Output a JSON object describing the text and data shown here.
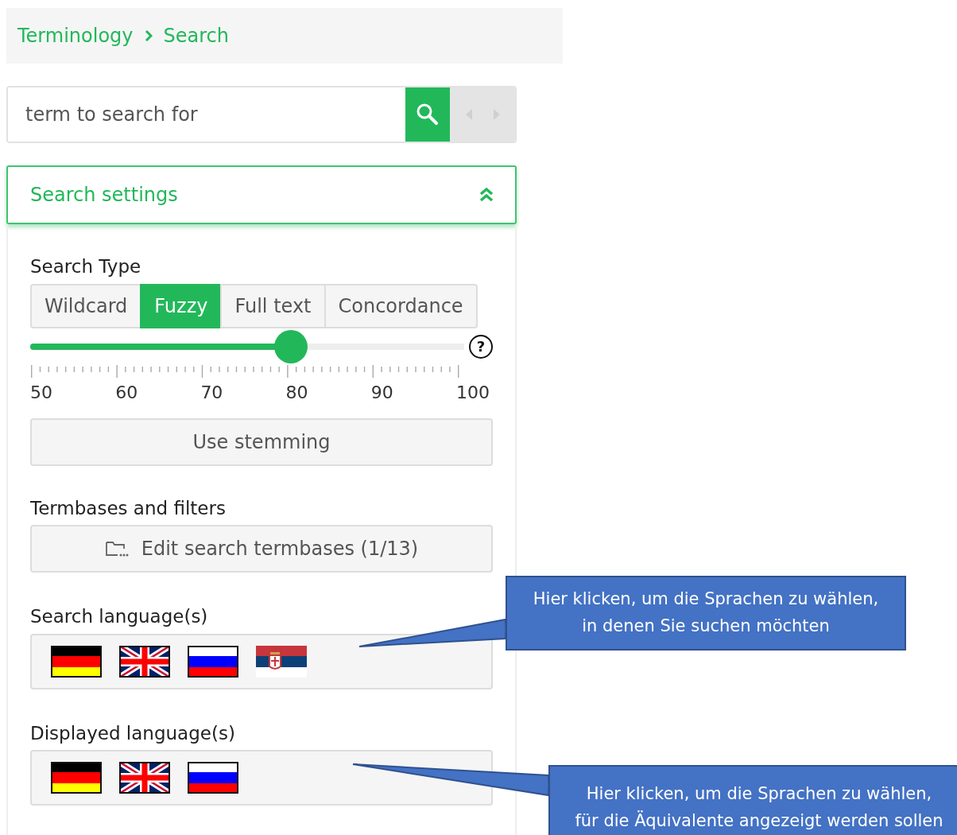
{
  "breadcrumb": [
    {
      "label": "Terminology"
    },
    {
      "label": "Search"
    }
  ],
  "search": {
    "placeholder": "term to search for"
  },
  "settings_panel": {
    "title": "Search settings",
    "expanded": true
  },
  "search_type": {
    "label": "Search Type",
    "options": [
      {
        "label": "Wildcard",
        "selected": false
      },
      {
        "label": "Fuzzy",
        "selected": true
      },
      {
        "label": "Full text",
        "selected": false
      },
      {
        "label": "Concordance",
        "selected": false
      }
    ]
  },
  "fuzzy_slider": {
    "level": 0.6,
    "tick_labels": [
      "50",
      "60",
      "70",
      "80",
      "90",
      "100"
    ],
    "help": "?"
  },
  "stemming_button": {
    "label": "Use stemming"
  },
  "termbases": {
    "label": "Termbases and filters",
    "button": "Edit search termbases (1/13)"
  },
  "search_languages": {
    "label": "Search language(s)",
    "flags": [
      {
        "kind": "de"
      },
      {
        "kind": "gb"
      },
      {
        "kind": "ru"
      },
      {
        "kind": "rs"
      }
    ]
  },
  "displayed_languages": {
    "label": "Displayed language(s)",
    "flags": [
      {
        "kind": "de"
      },
      {
        "kind": "gb"
      },
      {
        "kind": "ru"
      }
    ]
  },
  "callouts": [
    {
      "text": "Hier klicken, um die Sprachen zu wählen,\nin denen Sie suchen möchten"
    },
    {
      "text": "Hier klicken, um die Sprachen zu wählen,\nfür die Äquivalente angezeigt werden sollen"
    }
  ]
}
